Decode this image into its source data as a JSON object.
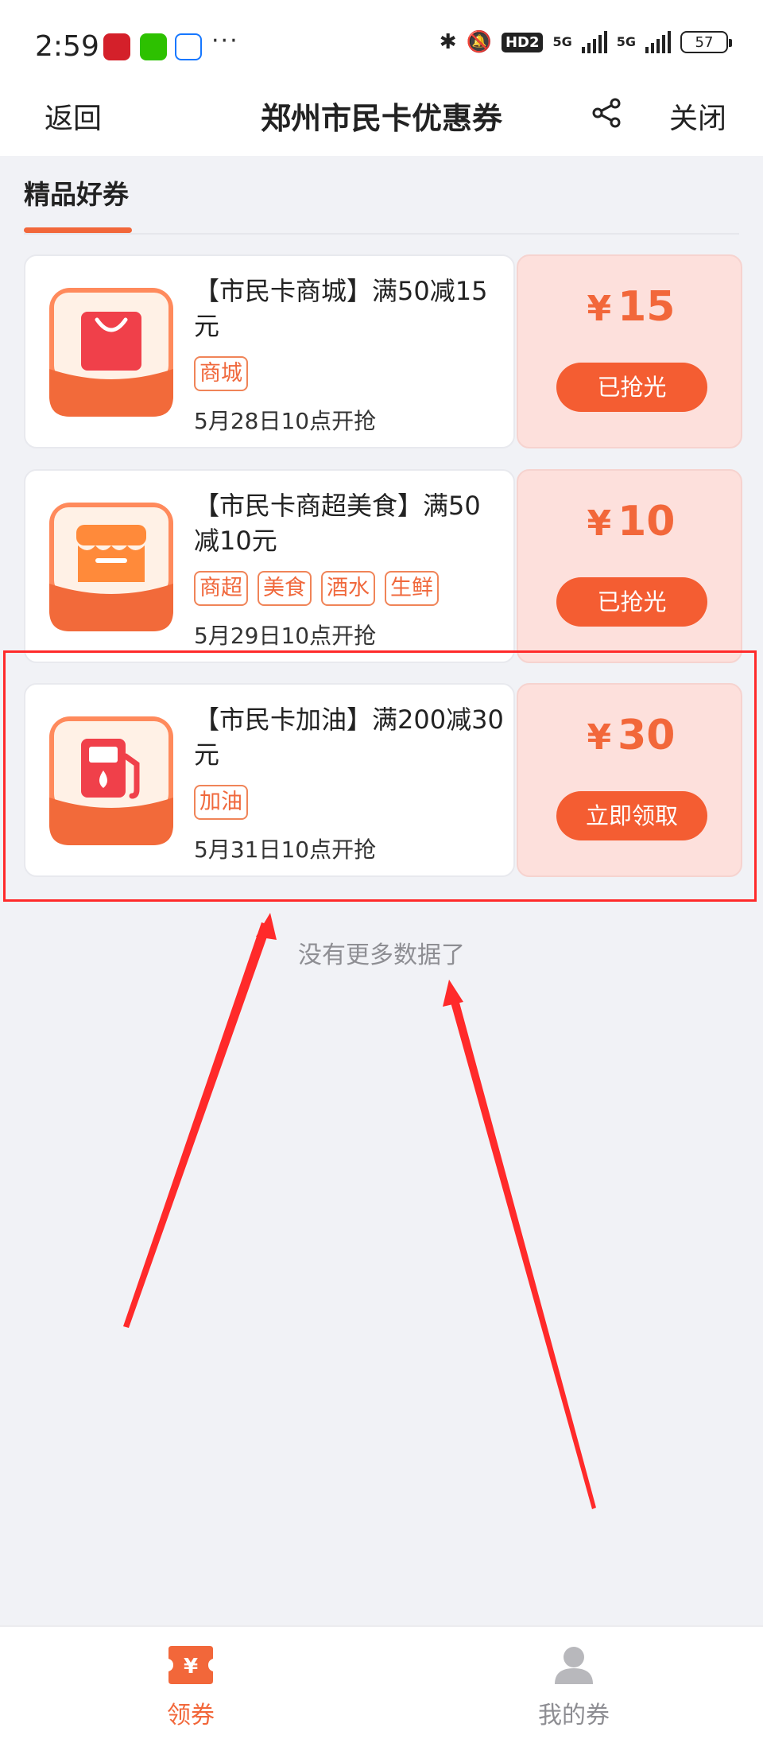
{
  "status_bar": {
    "time": "2:59",
    "more": "···",
    "hd_badge": "HD2",
    "signal1": "5G",
    "signal2": "5G",
    "battery": "57"
  },
  "nav": {
    "back": "返回",
    "title": "郑州市民卡优惠券",
    "close": "关闭"
  },
  "tab": {
    "label": "精品好券"
  },
  "coupons": [
    {
      "title": "【市民卡商城】满50减15元",
      "tags": [
        "商城"
      ],
      "date": "5月28日10点开抢",
      "currency": "¥",
      "amount": "15",
      "button": "已抢光",
      "icon": "shopping-bag-icon"
    },
    {
      "title": "【市民卡商超美食】满50减10元",
      "tags": [
        "商超",
        "美食",
        "酒水",
        "生鲜"
      ],
      "date": "5月29日10点开抢",
      "currency": "¥",
      "amount": "10",
      "button": "已抢光",
      "icon": "store-icon"
    },
    {
      "title": "【市民卡加油】满200减30元",
      "tags": [
        "加油"
      ],
      "date": "5月31日10点开抢",
      "currency": "¥",
      "amount": "30",
      "button": "立即领取",
      "icon": "fuel-pump-icon"
    }
  ],
  "list_end": "没有更多数据了",
  "bottom_tabs": {
    "get": "领券",
    "mine": "我的券"
  },
  "colors": {
    "accent": "#f2673a",
    "button": "#f45d32",
    "price_bg": "#fde0dc",
    "annotation_red": "#ff2a2a"
  }
}
